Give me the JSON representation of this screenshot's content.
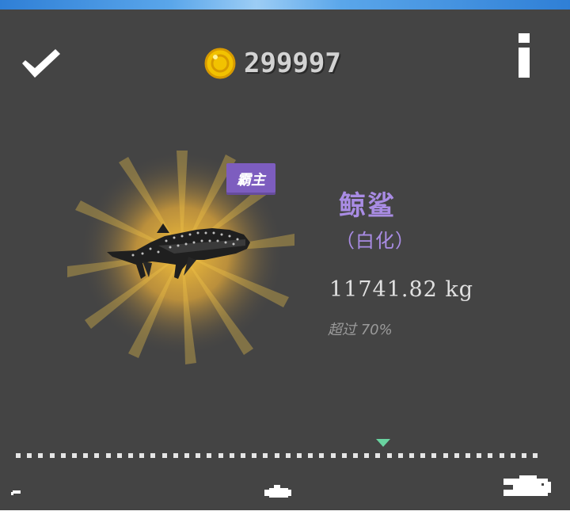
{
  "header": {
    "check_icon": "checkmark-icon",
    "coin_icon": "coin-icon",
    "coin_count": "299997",
    "info_icon": "info-icon"
  },
  "fish": {
    "rank_badge": "霸主",
    "name": "鲸鲨",
    "variant": "（白化）",
    "weight": "11741.82 kg",
    "percentile_text": "超过 70%",
    "art_icon": "whale-shark-icon"
  },
  "size_scale": {
    "marker_position_fraction": 0.71,
    "small_icon": "small-fish-icon",
    "medium_icon": "medium-fish-icon",
    "large_icon": "large-fish-icon"
  },
  "colors": {
    "panel_bg": "#444444",
    "accent_purple": "#a98ce4",
    "badge_purple": "#7d5dbf",
    "marker_green": "#69d3a0",
    "coin_gold": "#f2c200"
  }
}
